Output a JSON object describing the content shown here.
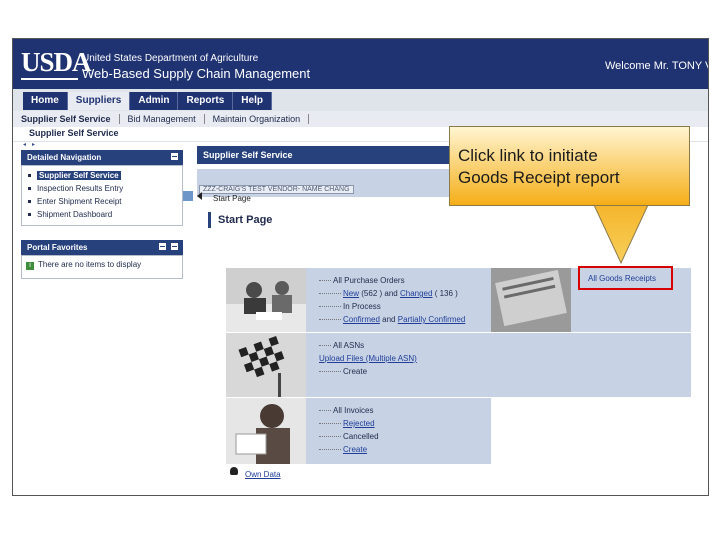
{
  "banner": {
    "logo": "USDA",
    "agency": "United States Department of Agriculture",
    "app_name": "Web-Based Supply Chain Management",
    "welcome": "Welcome Mr. TONY V"
  },
  "nav": {
    "tabs": [
      "Home",
      "Suppliers",
      "Admin",
      "Reports",
      "Help"
    ],
    "active_tab": "Suppliers"
  },
  "subnav": {
    "items": [
      "Supplier Self Service",
      "Bid Management",
      "Maintain Organization"
    ]
  },
  "breadcrumb": "Supplier Self Service",
  "left_panel": {
    "toggle": [
      "◂",
      "▸"
    ],
    "detailed_navigation": {
      "title": "Detailed Navigation",
      "items": [
        "Supplier Self Service",
        "Inspection Results Entry",
        "Enter Shipment Receipt",
        "Shipment Dashboard"
      ]
    },
    "portal_favorites": {
      "title": "Portal Favorites",
      "empty_text": "There are no items to display"
    }
  },
  "main": {
    "header": "Supplier Self Service",
    "vendor": "ZZZ-CRAIG'S TEST VENDOR- NAME CHANG",
    "start_crumb": "Start Page",
    "title": "Start Page",
    "purchase_orders": {
      "all": "All Purchase Orders",
      "new": "New",
      "new_count": "(562 )",
      "and": "and",
      "changed": "Changed",
      "changed_count": "( 136 )",
      "in_process": "In Process",
      "confirmed": "Confirmed",
      "and2": "and",
      "partially_confirmed": "Partially Confirmed"
    },
    "goods_receipts": "All Goods Receipts",
    "asns": {
      "all": "All ASNs",
      "upload": "Upload Files (Multiple ASN)",
      "create": "Create"
    },
    "invoices": {
      "all": "All Invoices",
      "rejected": "Rejected",
      "cancelled": "Cancelled",
      "create": "Create"
    },
    "own_data": "Own Data"
  },
  "callout": {
    "line1": "Click link to initiate",
    "line2": "Goods Receipt report"
  },
  "colors": {
    "brand_navy": "#1f3272",
    "panel_blue": "#c7d3e4",
    "highlight_red": "#d60000",
    "callout_orange": "#f5ae17"
  }
}
